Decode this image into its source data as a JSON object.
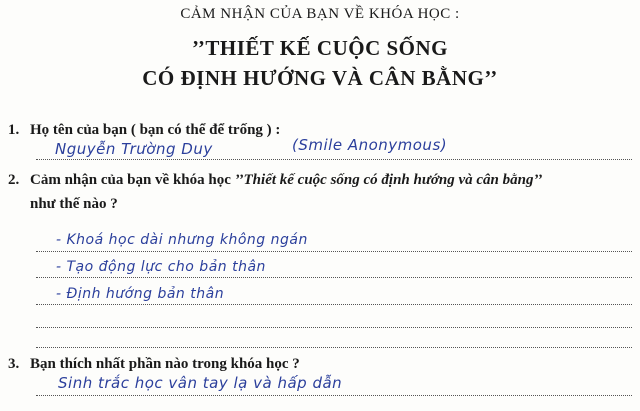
{
  "header": {
    "subtitle": "CẢM NHẬN CỦA BẠN VỀ KHÓA HỌC :",
    "title_line1": "’’THIẾT KẾ CUỘC SỐNG",
    "title_line2": "CÓ ĐỊNH HƯỚNG VÀ CÂN BẰNG’’"
  },
  "questions": [
    {
      "number": "1.",
      "text": "Họ tên của bạn ( bạn có thể để trống ) :",
      "answers": [
        "Nguyễn Trường Duy",
        "(Smile Anonymous)"
      ]
    },
    {
      "number": "2.",
      "text_prefix": "Cảm nhận của bạn về khóa học ",
      "text_italic": "’’Thiết kế cuộc sống có định hướng và cân bằng’’",
      "text_suffix": "như thế nào ?",
      "answers": [
        "- Khoá học dài nhưng không ngán",
        "- Tạo động lực cho bản thân",
        "- Định hướng bản thân"
      ]
    },
    {
      "number": "3.",
      "text": "Bạn thích nhất phần nào trong khóa học ?",
      "answers": [
        "Sinh trắc học vân tay lạ và hấp dẫn"
      ]
    }
  ],
  "colors": {
    "ink": "#2b3f9c",
    "print": "#1a1a1a",
    "paper": "#fdfdfb"
  }
}
